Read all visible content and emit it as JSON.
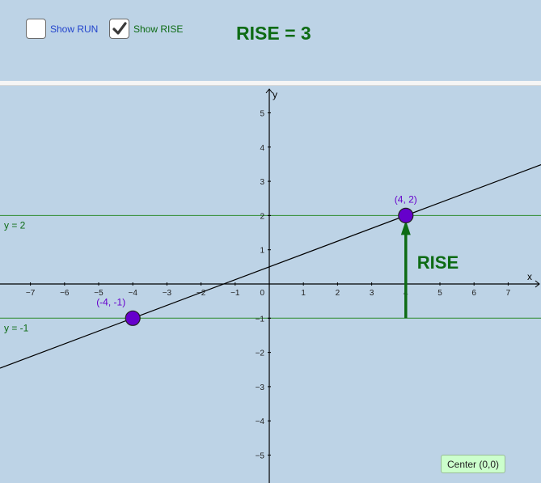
{
  "controls": {
    "show_run": {
      "label": "Show RUN",
      "checked": false,
      "color": "#2244cc"
    },
    "show_rise": {
      "label": "Show RISE",
      "checked": true,
      "color": "#0d6b14"
    },
    "rise_readout": "RISE = 3",
    "center_button": "Center (0,0)"
  },
  "graph": {
    "axis_labels": {
      "x": "x",
      "y": "y"
    },
    "x_ticks": [
      -7,
      -6,
      -5,
      -4,
      -3,
      -2,
      -1,
      1,
      2,
      3,
      4,
      5,
      6,
      7
    ],
    "x_tick_labels": [
      "−7",
      "−6",
      "−5",
      "−4",
      "−3",
      "−2",
      "−1",
      "1",
      "2",
      "3",
      "4",
      "5",
      "6",
      "7"
    ],
    "y_ticks": [
      -5,
      -4,
      -3,
      -2,
      -1,
      1,
      2,
      3,
      4,
      5
    ],
    "y_tick_labels": [
      "−5",
      "−4",
      "−3",
      "−2",
      "−1",
      "1",
      "2",
      "3",
      "4",
      "5"
    ],
    "origin_label": "0",
    "x_range": [
      -7.9,
      7.9
    ],
    "y_range": [
      -5.9,
      5.7
    ],
    "line": {
      "slope": 0.375,
      "intercept": 0.5,
      "color": "#000000"
    },
    "horizontal_lines": [
      {
        "y": 2,
        "label": "y = 2",
        "color": "#2e8b2e"
      },
      {
        "y": -1,
        "label": "y = -1",
        "color": "#2e8b2e"
      }
    ],
    "points": [
      {
        "x": -4,
        "y": -1,
        "label": "(-4, -1)",
        "color": "#6600cc"
      },
      {
        "x": 4,
        "y": 2,
        "label": "(4, 2)",
        "color": "#6600cc"
      }
    ],
    "rise_arrow": {
      "x": 4,
      "from_y": -1,
      "to_y": 2,
      "label": "RISE",
      "color": "#0d6b14"
    }
  }
}
